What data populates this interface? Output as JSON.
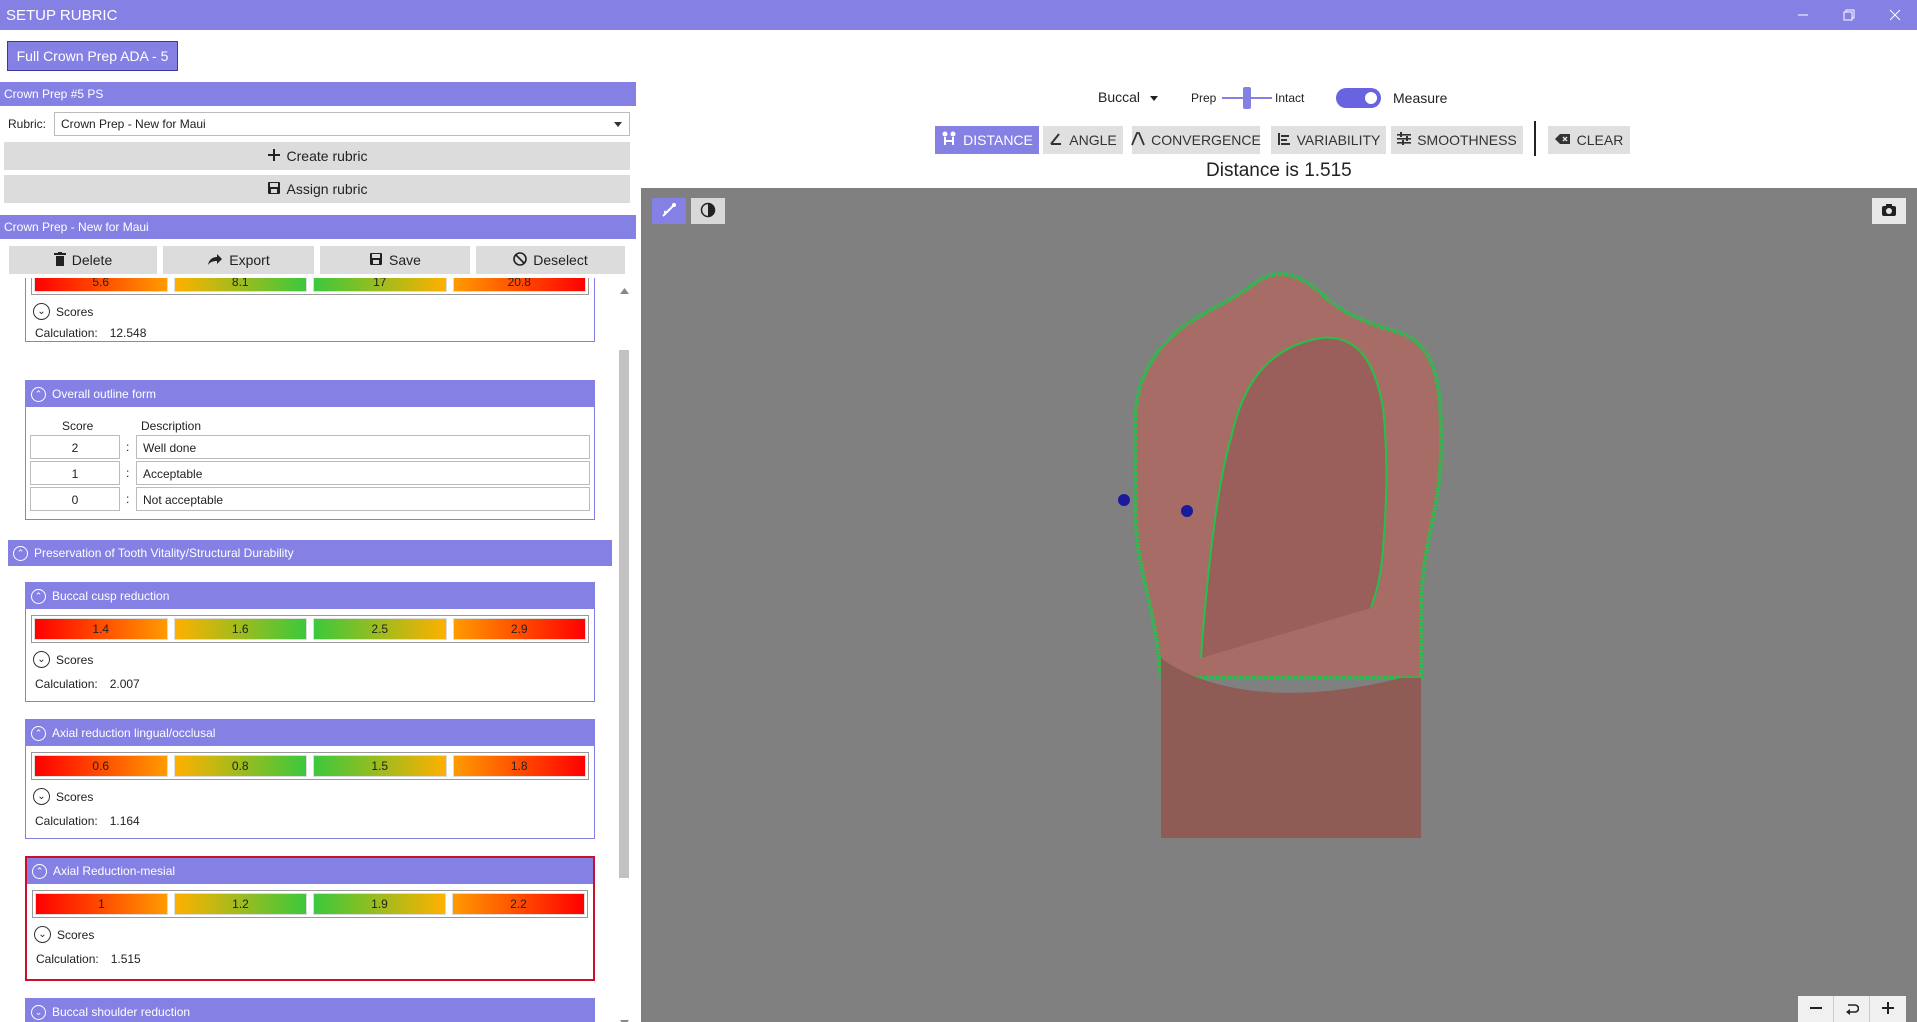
{
  "window": {
    "title": "SETUP RUBRIC"
  },
  "rubric_button": "Full Crown Prep ADA - 5",
  "left_panel": {
    "header": "Crown Prep #5 PS",
    "rubric_label": "Rubric:",
    "rubric_value": "Crown Prep - New for Maui",
    "create_label": "Create rubric",
    "assign_label": "Assign rubric",
    "rubric_header": "Crown Prep - New for Maui",
    "actions": {
      "delete": "Delete",
      "export": "Export",
      "save": "Save",
      "deselect": "Deselect"
    },
    "top_card": {
      "bars": [
        "5.6",
        "8.1",
        "17",
        "20.8"
      ],
      "scores_label": "Scores",
      "calc_label": "Calculation:",
      "calc_value": "12.548"
    },
    "outline_card": {
      "title": "Overall outline form",
      "col_score": "Score",
      "col_desc": "Description",
      "rows": [
        {
          "score": "2",
          "desc": "Well done"
        },
        {
          "score": "1",
          "desc": "Acceptable"
        },
        {
          "score": "0",
          "desc": "Not acceptable"
        }
      ]
    },
    "section_title": "Preservation of Tooth Vitality/Structural Durability",
    "cards": [
      {
        "title": "Buccal cusp reduction",
        "bars": [
          "1.4",
          "1.6",
          "2.5",
          "2.9"
        ],
        "scores_label": "Scores",
        "calc_label": "Calculation:",
        "calc_value": "2.007"
      },
      {
        "title": "Axial reduction lingual/occlusal",
        "bars": [
          "0.6",
          "0.8",
          "1.5",
          "1.8"
        ],
        "scores_label": "Scores",
        "calc_label": "Calculation:",
        "calc_value": "1.164"
      },
      {
        "title": "Axial Reduction-mesial",
        "bars": [
          "1",
          "1.2",
          "1.9",
          "2.2"
        ],
        "scores_label": "Scores",
        "calc_label": "Calculation:",
        "calc_value": "1.515"
      },
      {
        "title": "Buccal shoulder reduction"
      }
    ]
  },
  "toolbar": {
    "view_select": "Buccal",
    "prep_label": "Prep",
    "intact_label": "Intact",
    "measure_label": "Measure",
    "tabs": [
      "DISTANCE",
      "ANGLE",
      "CONVERGENCE",
      "VARIABILITY",
      "SMOOTHNESS"
    ],
    "clear": "CLEAR",
    "status": "Distance is 1.515"
  },
  "colors": {
    "accent": "#8580e4",
    "selected_border": "#c8102e",
    "viewport_bg": "#808080",
    "margin_line": "#22c24a",
    "tooth": "#a86c66"
  }
}
